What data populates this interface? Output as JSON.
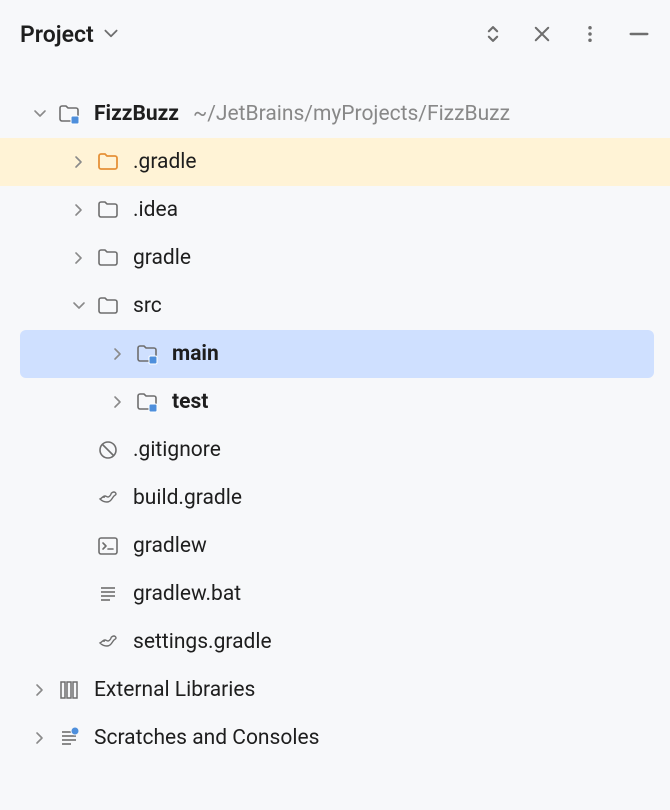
{
  "header": {
    "title": "Project"
  },
  "tree": {
    "root": {
      "label": "FizzBuzz",
      "path": "~/JetBrains/myProjects/FizzBuzz"
    },
    "items": [
      {
        "label": ".gradle"
      },
      {
        "label": ".idea"
      },
      {
        "label": "gradle"
      },
      {
        "label": "src"
      },
      {
        "label": "main"
      },
      {
        "label": "test"
      },
      {
        "label": ".gitignore"
      },
      {
        "label": "build.gradle"
      },
      {
        "label": "gradlew"
      },
      {
        "label": "gradlew.bat"
      },
      {
        "label": "settings.gradle"
      }
    ],
    "external": {
      "label": "External Libraries"
    },
    "scratches": {
      "label": "Scratches and Consoles"
    }
  }
}
